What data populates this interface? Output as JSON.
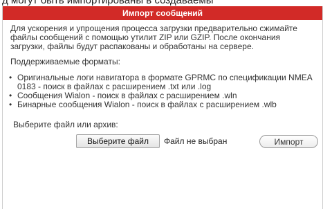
{
  "background_text": "д могут быть импортированы в создаваемы",
  "dialog": {
    "title": "Импорт сообщений",
    "description": "Для ускорения и упрощения процесса загрузки предварительно сжимайте файлы сообщений с помощью утилит ZIP или GZIP. После окончания загрузки, файлы будут распакованы и обработаны на сервере.",
    "formats_title": "Поддерживаемые форматы:",
    "formats": [
      "Оригинальные логи навигатора в формате GPRMC по спецификации NMEA 0183 - поиск в файлах с расширением .txt или .log",
      "Сообщения Wialon - поиск в файлах с расширением .wln",
      "Бинарные сообщения Wialon - поиск в файлах с расширением .wlb"
    ],
    "choose_label": "Выберите файл или архив:",
    "file_button_label": "Выберите файл",
    "file_status": "Файл не выбран",
    "import_button_label": "Импорт"
  },
  "colors": {
    "header_bg": "#d22a27",
    "header_text": "#ffffff"
  }
}
